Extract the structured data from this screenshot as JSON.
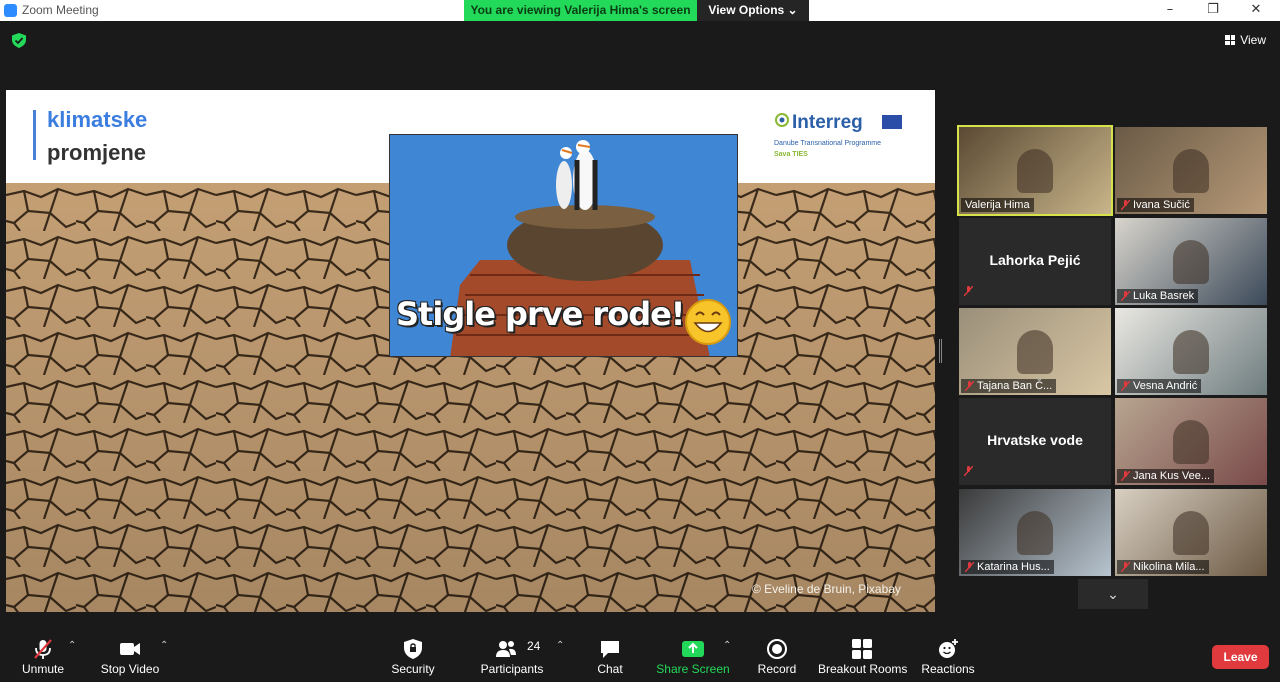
{
  "window": {
    "title": "Zoom Meeting",
    "minimize": "–",
    "restore": "❐",
    "close": "✕"
  },
  "banner": {
    "viewing_text": "You are viewing Valerija Hima's screen",
    "view_options": "View Options ⌄"
  },
  "top_right": {
    "view_label": "View"
  },
  "slide": {
    "title_line1": "klimatske",
    "title_line2": "promjene",
    "logo_name": "Interreg",
    "logo_sub1": "Danube Transnational Programme",
    "logo_sub2": "Sava TIES",
    "inset_caption": "Stigle prve rode!",
    "photo_credit": "© Eveline de Bruin, Pixabay"
  },
  "participants": [
    {
      "name": "Valerija Hima",
      "video": true,
      "muted": false,
      "active": true
    },
    {
      "name": "Ivana Sučić",
      "video": true,
      "muted": true,
      "active": false
    },
    {
      "name": "Lahorka Pejić",
      "video": false,
      "muted": true,
      "active": false
    },
    {
      "name": "Luka Basrek",
      "video": true,
      "muted": true,
      "active": false
    },
    {
      "name": "Tajana Ban Č...",
      "video": true,
      "muted": true,
      "active": false
    },
    {
      "name": "Vesna Andrić",
      "video": true,
      "muted": true,
      "active": false
    },
    {
      "name": "Hrvatske vode",
      "video": false,
      "muted": true,
      "active": false
    },
    {
      "name": "Jana Kus Vee...",
      "video": true,
      "muted": true,
      "active": false
    },
    {
      "name": "Katarina Hus...",
      "video": true,
      "muted": true,
      "active": false
    },
    {
      "name": "Nikolina Mila...",
      "video": true,
      "muted": true,
      "active": false
    }
  ],
  "toolbar": {
    "unmute": "Unmute",
    "stop_video": "Stop Video",
    "security": "Security",
    "participants": "Participants",
    "participants_count": "24",
    "chat": "Chat",
    "share_screen": "Share Screen",
    "record": "Record",
    "breakout_rooms": "Breakout Rooms",
    "reactions": "Reactions",
    "leave": "Leave"
  },
  "colors": {
    "banner_green": "#23d959",
    "active_speaker": "#d6e24a",
    "leave_red": "#e0393e",
    "share_green": "#23d959",
    "mute_red": "#e0393e"
  }
}
